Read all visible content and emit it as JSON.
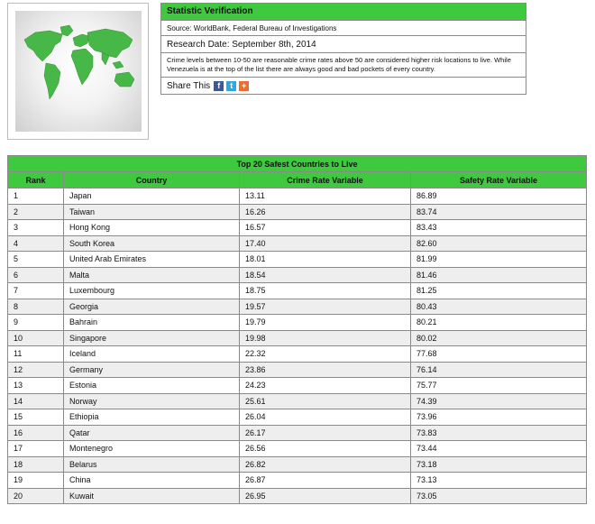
{
  "image": {
    "icon": "world-map-icon",
    "accent": "#3ec93e"
  },
  "stat": {
    "title": "Statistic Verification",
    "source": "Source: WorldBank, Federal Bureau of Investigations",
    "date": "Research Date: September 8th, 2014",
    "description": "Crime levels between 10-50 are reasonable crime rates above 50 are considered higher risk locations to live. While Venezuela is at the top of the list there are always good and bad pockets of every country.",
    "share_label": "Share This",
    "share_icons": [
      "facebook-icon",
      "twitter-icon",
      "plus-icon"
    ]
  },
  "table": {
    "title": "Top 20 Safest Countries to Live",
    "headers": [
      "Rank",
      "Country",
      "Crime Rate Variable",
      "Safety Rate Variable"
    ],
    "rows": [
      [
        "1",
        "Japan",
        "13.11",
        "86.89"
      ],
      [
        "2",
        "Taiwan",
        "16.26",
        "83.74"
      ],
      [
        "3",
        "Hong Kong",
        "16.57",
        "83.43"
      ],
      [
        "4",
        "South Korea",
        "17.40",
        "82.60"
      ],
      [
        "5",
        "United Arab Emirates",
        "18.01",
        "81.99"
      ],
      [
        "6",
        "Malta",
        "18.54",
        "81.46"
      ],
      [
        "7",
        "Luxembourg",
        "18.75",
        "81.25"
      ],
      [
        "8",
        "Georgia",
        "19.57",
        "80.43"
      ],
      [
        "9",
        "Bahrain",
        "19.79",
        "80.21"
      ],
      [
        "10",
        "Singapore",
        "19.98",
        "80.02"
      ],
      [
        "11",
        "Iceland",
        "22.32",
        "77.68"
      ],
      [
        "12",
        "Germany",
        "23.86",
        "76.14"
      ],
      [
        "13",
        "Estonia",
        "24.23",
        "75.77"
      ],
      [
        "14",
        "Norway",
        "25.61",
        "74.39"
      ],
      [
        "15",
        "Ethiopia",
        "26.04",
        "73.96"
      ],
      [
        "16",
        "Qatar",
        "26.17",
        "73.83"
      ],
      [
        "17",
        "Montenegro",
        "26.56",
        "73.44"
      ],
      [
        "18",
        "Belarus",
        "26.82",
        "73.18"
      ],
      [
        "19",
        "China",
        "26.87",
        "73.13"
      ],
      [
        "20",
        "Kuwait",
        "26.95",
        "73.05"
      ]
    ]
  }
}
